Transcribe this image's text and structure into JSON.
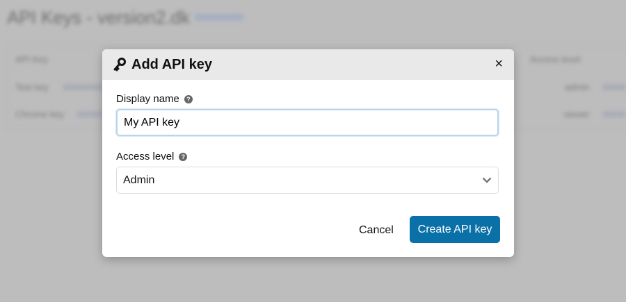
{
  "background": {
    "title": "API Keys - version2.dk",
    "table_header_name": "API Key",
    "table_header_access": "Access level",
    "rows": [
      {
        "name": "Test key",
        "access": "admin"
      },
      {
        "name": "Chrome key",
        "access": "viewer"
      }
    ]
  },
  "modal": {
    "title": "Add API key",
    "title_icon": "key-icon",
    "close_label": "×",
    "display_name_label": "Display name",
    "display_name_value": "My API key",
    "access_level_label": "Access level",
    "access_level_value": "Admin",
    "help_glyph": "?",
    "cancel_label": "Cancel",
    "create_label": "Create API key",
    "accent_color": "#0a70a8"
  }
}
